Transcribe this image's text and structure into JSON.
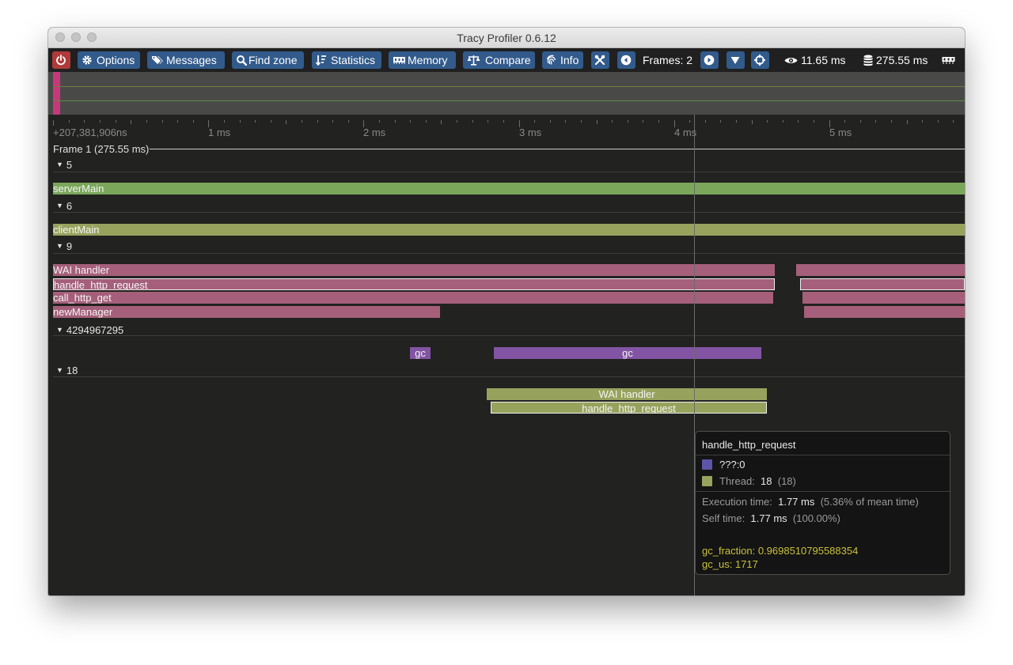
{
  "window": {
    "title": "Tracy Profiler 0.6.12"
  },
  "toolbar": {
    "options": "Options",
    "messages": "Messages",
    "find_zone": "Find zone",
    "statistics": "Statistics",
    "memory": "Memory",
    "compare": "Compare",
    "info": "Info",
    "frames_label": "Frames: 2",
    "view_time": "11.65 ms",
    "total_time": "275.55 ms"
  },
  "ruler": {
    "start": "+207,381,906ns",
    "ticks": [
      "1 ms",
      "2 ms",
      "3 ms",
      "4 ms",
      "5 ms"
    ]
  },
  "frame": {
    "label": "Frame 1 (275.55 ms)"
  },
  "threads": [
    {
      "id": "5",
      "zones": [
        "serverMain"
      ]
    },
    {
      "id": "6",
      "zones": [
        "clientMain"
      ]
    },
    {
      "id": "9",
      "zones": [
        "WAI handler",
        "handle_http_request",
        "call_http_get",
        "newManager"
      ]
    },
    {
      "id": "4294967295",
      "zones": [
        "gc",
        "gc"
      ]
    },
    {
      "id": "18",
      "zones": [
        "WAI handler",
        "handle_http_request"
      ]
    }
  ],
  "tooltip": {
    "title": "handle_http_request",
    "source": "???:0",
    "thread_label": "Thread:",
    "thread_value": "18",
    "thread_paren": "(18)",
    "exec_label": "Execution time:",
    "exec_value": "1.77 ms",
    "exec_note": "(5.36% of mean time)",
    "self_label": "Self time:",
    "self_value": "1.77 ms",
    "self_note": "(100.00%)",
    "gc_fraction": "gc_fraction: 0.9698510795588354",
    "gc_us": "gc_us: 1717"
  },
  "colors": {
    "button": "#325b8c",
    "quit": "#b03a3a",
    "zone_green": "#7ba75b",
    "zone_olive": "#97a35d",
    "zone_pink": "#a55f7a",
    "zone_purple": "#8254a3",
    "annotation_yellow": "#c8c03a"
  },
  "icons": [
    "power-icon",
    "gear-icon",
    "tags-icon",
    "search-icon",
    "sort-icon",
    "memory-icon",
    "scale-icon",
    "fingerprint-icon",
    "tools-icon",
    "caret-left-icon",
    "caret-right-icon",
    "caret-down-icon",
    "crosshair-icon",
    "eye-icon",
    "database-icon"
  ]
}
